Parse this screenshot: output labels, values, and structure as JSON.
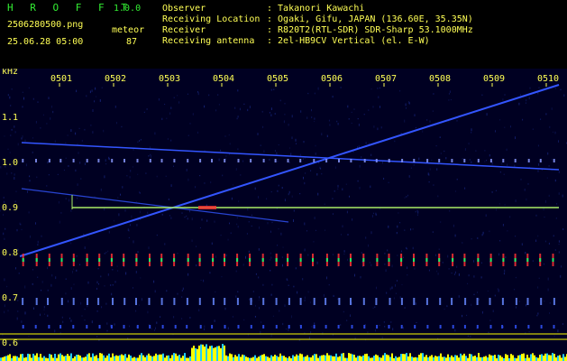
{
  "header": {
    "app_title": "H R O F F T",
    "version": "1.0.0",
    "filename": "2506280500.png",
    "mode_label": "meteor",
    "datetime": "25.06.28 05:00",
    "count": "87",
    "observer_label": "Observer",
    "observer_value": ": Takanori Kawachi",
    "location_label": "Receiving Location",
    "location_value": ": Ogaki, Gifu, JAPAN (136.60E, 35.35N)",
    "receiver_label": "Receiver",
    "receiver_value": ": R820T2(RTL-SDR) SDR-Sharp 53.1000MHz",
    "antenna_label": "Receiving antenna",
    "antenna_value": ": 2el-HB9CV Vertical (el. E-W)"
  },
  "axes": {
    "y_unit": "kHz",
    "y_ticks": [
      "1.1",
      "1.0",
      "0.9",
      "0.8",
      "0.7",
      "0.6"
    ],
    "x_ticks": [
      "0501",
      "0502",
      "0503",
      "0504",
      "0505",
      "0506",
      "0507",
      "0508",
      "0509",
      "0510"
    ]
  },
  "colors": {
    "background": "#000022",
    "header_text": "#ffff55",
    "title_text": "#33ee33",
    "axis_text": "#ffff55",
    "trace_blue": "#3355ff",
    "carrier_line": "#aaee66",
    "meteor_red": "#ff3333",
    "bottom_level": "#ffff00",
    "bottom_cyan": "#22ccff"
  }
}
